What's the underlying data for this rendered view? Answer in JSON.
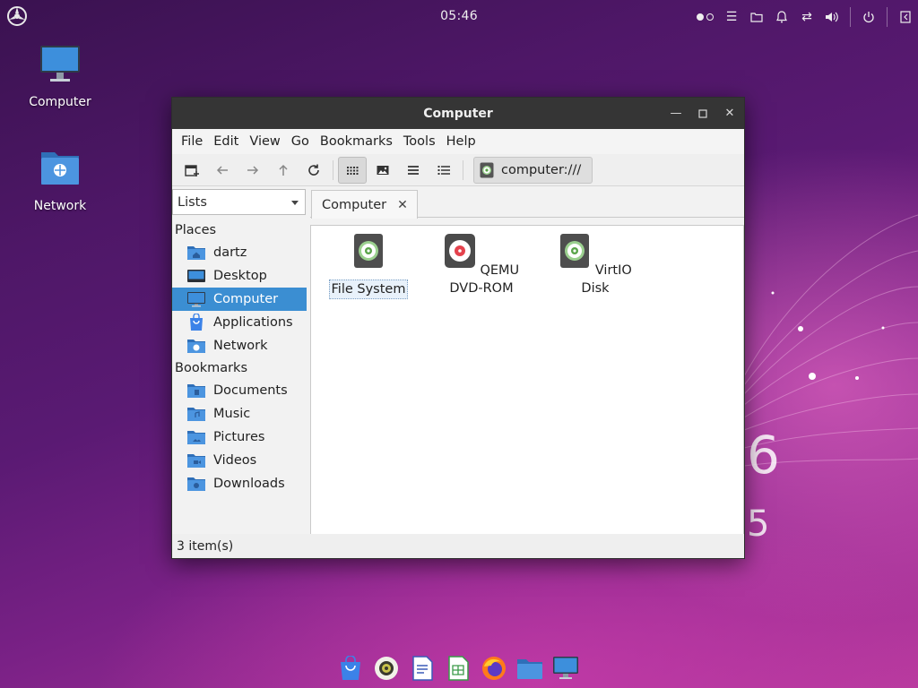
{
  "top_panel": {
    "clock": "05:46",
    "tray_icons": [
      "workspace-indicator-icon",
      "menu-icon",
      "folder-icon",
      "bell-icon",
      "network-transfer-icon",
      "volume-icon",
      "power-icon",
      "exit-icon"
    ]
  },
  "desktop": {
    "icons": [
      {
        "label": "Computer",
        "icon": "monitor-icon"
      },
      {
        "label": "Network",
        "icon": "network-folder-icon"
      }
    ]
  },
  "window": {
    "title": "Computer",
    "menu": [
      "File",
      "Edit",
      "View",
      "Go",
      "Bookmarks",
      "Tools",
      "Help"
    ],
    "location": "computer:///",
    "side_pane_mode": "Lists",
    "tab_label": "Computer",
    "sidebar": {
      "places_header": "Places",
      "places": [
        {
          "label": "dartz",
          "icon": "home-folder-icon"
        },
        {
          "label": "Desktop",
          "icon": "desktop-icon"
        },
        {
          "label": "Computer",
          "icon": "computer-icon",
          "selected": true
        },
        {
          "label": "Applications",
          "icon": "applications-icon"
        },
        {
          "label": "Network",
          "icon": "network-folder-icon"
        }
      ],
      "bookmarks_header": "Bookmarks",
      "bookmarks": [
        {
          "label": "Documents",
          "icon": "documents-folder-icon"
        },
        {
          "label": "Music",
          "icon": "music-folder-icon"
        },
        {
          "label": "Pictures",
          "icon": "pictures-folder-icon"
        },
        {
          "label": "Videos",
          "icon": "videos-folder-icon"
        },
        {
          "label": "Downloads",
          "icon": "downloads-folder-icon"
        }
      ]
    },
    "files": [
      {
        "label": "File System",
        "icon": "drive-icon",
        "selected": true
      },
      {
        "label": "QEMU DVD-ROM",
        "icon": "optical-drive-icon"
      },
      {
        "label": "VirtIO Disk",
        "icon": "drive-icon"
      }
    ],
    "status": "3 item(s)"
  },
  "dock": {
    "apps": [
      "app-store-icon",
      "media-player-icon",
      "text-editor-icon",
      "spreadsheet-icon",
      "firefox-icon",
      "file-manager-icon",
      "computer-icon"
    ]
  },
  "colors": {
    "accent": "#3b8ed2",
    "titlebar": "#353535"
  }
}
